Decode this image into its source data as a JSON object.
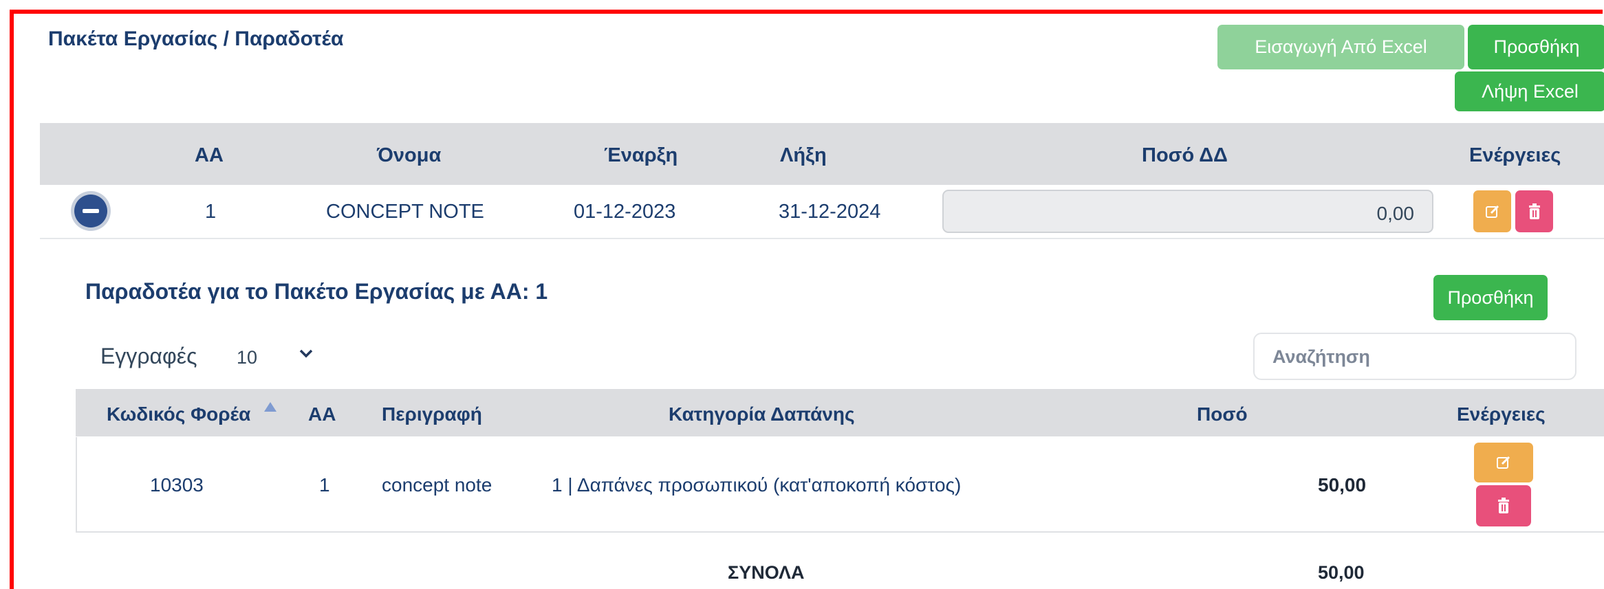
{
  "page": {
    "title": "Πακέτα Εργασίας / Παραδοτέα",
    "buttons": {
      "import_excel": "Εισαγωγή Από Excel",
      "add": "Προσθήκη",
      "download_excel": "Λήψη Excel"
    }
  },
  "work_packages": {
    "columns": [
      "ΑΑ",
      "Όνομα",
      "Έναρξη",
      "Λήξη",
      "Ποσό ΔΔ",
      "Ενέργειες"
    ],
    "rows": [
      {
        "aa": "1",
        "name": "CONCEPT NOTE",
        "start": "01-12-2023",
        "end": "31-12-2024",
        "amount": "0,00"
      }
    ]
  },
  "deliverables": {
    "title": "Παραδοτέα για το Πακέτο Εργασίας με ΑΑ: 1",
    "add_button": "Προσθήκη",
    "entries_label": "Εγγραφές",
    "entries_value": "10",
    "search_placeholder": "Αναζήτηση",
    "columns": [
      "Κωδικός Φορέα",
      "ΑΑ",
      "Περιγραφή",
      "Κατηγορία Δαπάνης",
      "Ποσό",
      "Ενέργειες"
    ],
    "rows": [
      {
        "code": "10303",
        "aa": "1",
        "description": "concept note",
        "category": "1 | Δαπάνες προσωπικού (κατ'αποκοπή κόστος)",
        "amount": "50,00"
      }
    ],
    "totals_label": "ΣΥΝΟΛΑ",
    "totals_value": "50,00"
  },
  "icons": {
    "collapse": "minus-circle-icon",
    "edit": "edit-icon",
    "delete": "trash-icon",
    "sort": "sort-up-icon",
    "dropdown": "chevron-down-icon"
  },
  "colors": {
    "success": "#3bb64f",
    "success_light": "#8fd29a",
    "warning": "#f0ad4e",
    "danger": "#e8507b",
    "heading": "#1c3d6e",
    "frame": "#ff0000"
  }
}
